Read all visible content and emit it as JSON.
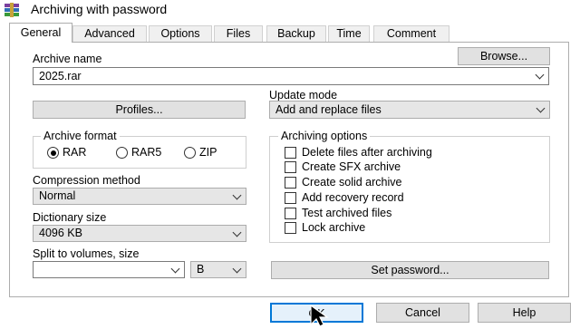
{
  "window": {
    "title": "Archiving with password"
  },
  "tabs": [
    "General",
    "Advanced",
    "Options",
    "Files",
    "Backup",
    "Time",
    "Comment"
  ],
  "archive_name": {
    "label": "Archive name",
    "value": "2025.rar",
    "browse_button": "Browse..."
  },
  "profiles_button": "Profiles...",
  "update_mode": {
    "label": "Update mode",
    "value": "Add and replace files"
  },
  "archive_format": {
    "label": "Archive format",
    "options": [
      "RAR",
      "RAR5",
      "ZIP"
    ],
    "selected": "RAR"
  },
  "compression_method": {
    "label": "Compression method",
    "value": "Normal"
  },
  "dictionary_size": {
    "label": "Dictionary size",
    "value": "4096 KB"
  },
  "split_volumes": {
    "label": "Split to volumes, size",
    "value": "",
    "unit": "B"
  },
  "archiving_options": {
    "label": "Archiving options",
    "items": [
      "Delete files after archiving",
      "Create SFX archive",
      "Create solid archive",
      "Add recovery record",
      "Test archived files",
      "Lock archive"
    ]
  },
  "set_password_button": "Set password...",
  "footer": {
    "ok": "OK",
    "cancel": "Cancel",
    "help": "Help"
  },
  "colors": {
    "ok_border": "#0078d7",
    "ok_fill": "#e5f1fb"
  }
}
